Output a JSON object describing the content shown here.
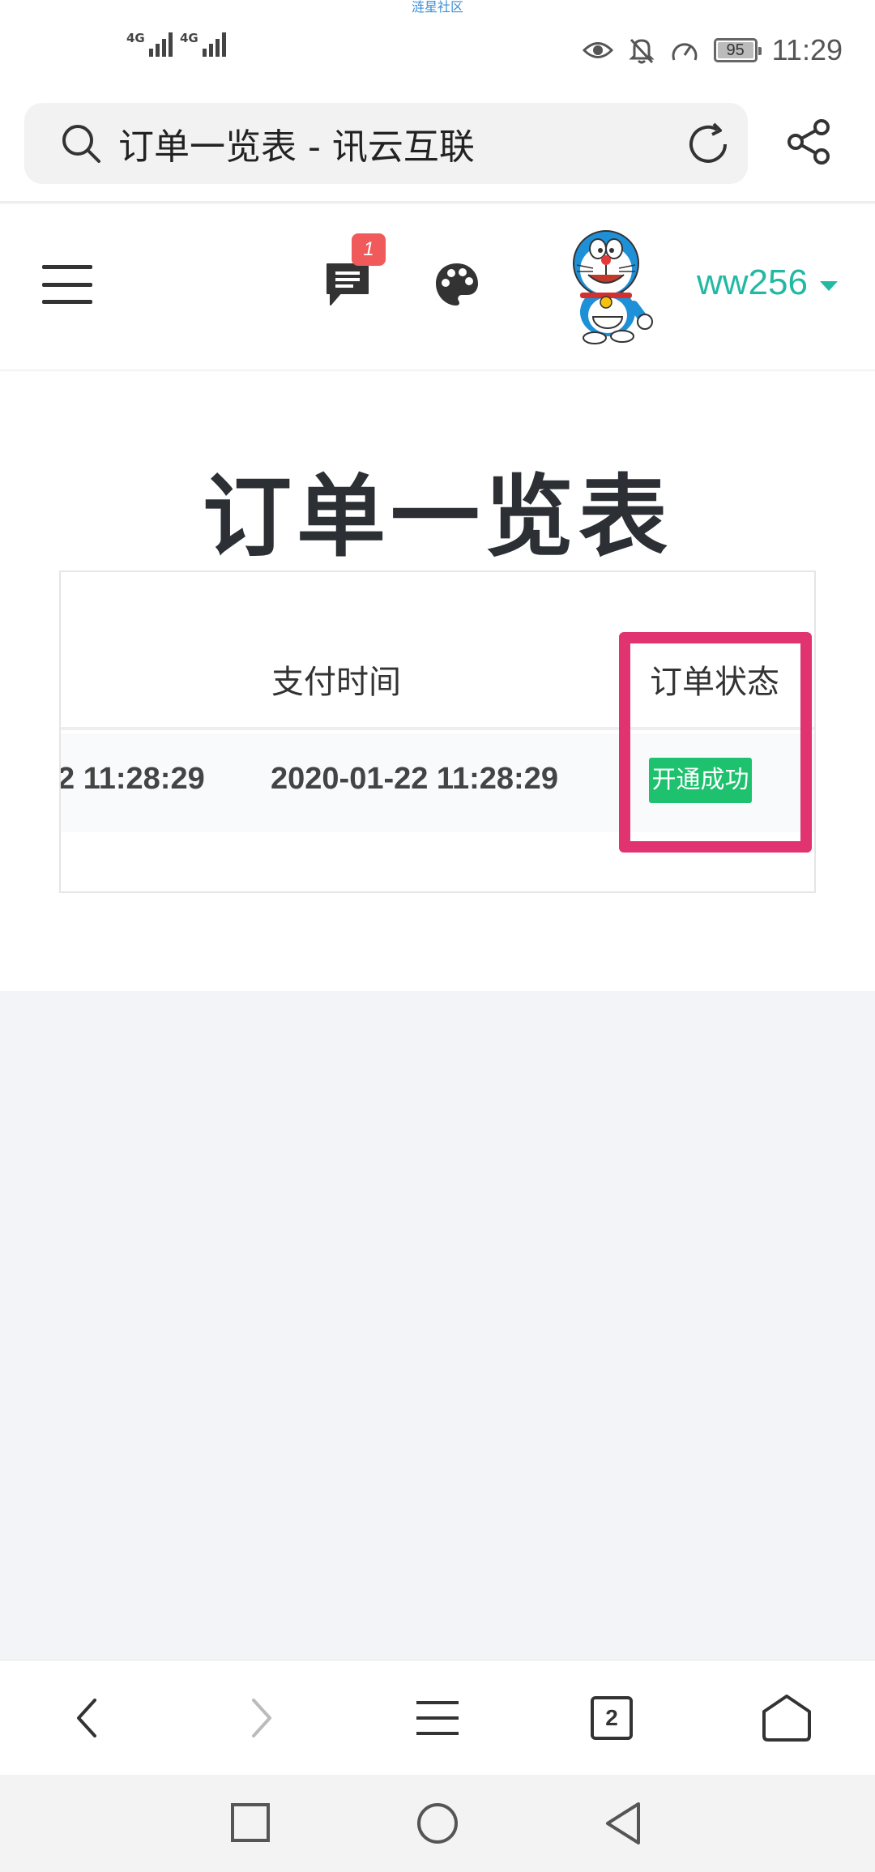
{
  "status_bar": {
    "watermark": "涟星社区",
    "network1": "4G",
    "network2": "4G",
    "battery_level": "95",
    "time": "11:29"
  },
  "browser": {
    "page_title": "订单一览表 - 讯云互联",
    "tab_count": "2"
  },
  "header": {
    "notification_count": "1",
    "username": "ww256"
  },
  "main": {
    "title": "订单一览表",
    "table": {
      "columns": [
        "支付时间",
        "订单状态"
      ],
      "rows": [
        {
          "truncated_time": "2 11:28:29",
          "pay_time": "2020-01-22 11:28:29",
          "status": "开通成功"
        }
      ]
    }
  },
  "colors": {
    "accent": "#22b9a3",
    "success": "#1ec26e",
    "highlight": "#e0336f",
    "badge": "#f15a5a"
  },
  "icons": [
    "search-icon",
    "reload-icon",
    "share-icon",
    "menu-icon",
    "message-icon",
    "palette-icon",
    "avatar",
    "back-icon",
    "forward-icon",
    "menu-icon",
    "tabs-icon",
    "home-icon"
  ]
}
